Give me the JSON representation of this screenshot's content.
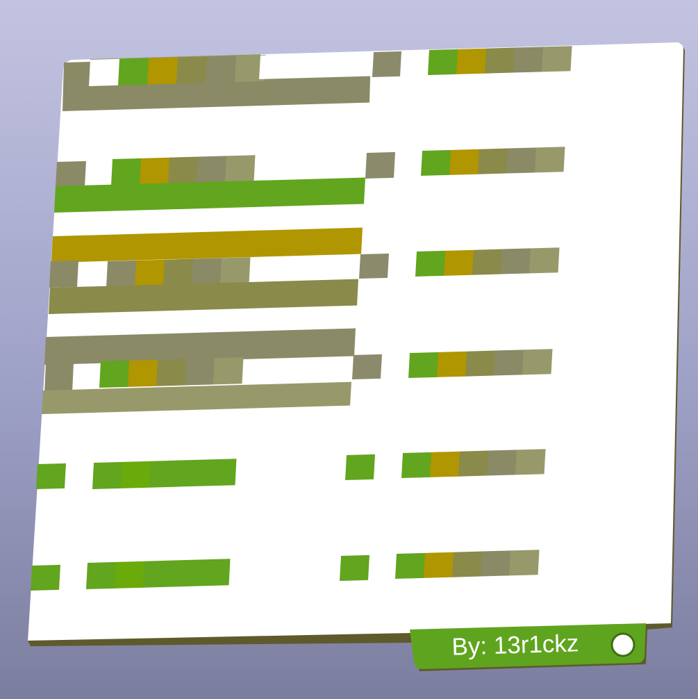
{
  "scene": {
    "description_type": "3d-render-of-pixel-art-plate",
    "colors": {
      "plate": "#ffffff",
      "plate_edge": "#5e5a2c",
      "tab": "#5fa41e",
      "hole": "#ffffff",
      "green": "#62a51e",
      "green2": "#6aaa0a",
      "gold": "#b09600",
      "olive": "#8a8a4a",
      "khaki": "#8a8a66",
      "sage": "#97996a",
      "taupe": "#8b8a6b"
    }
  },
  "tab": {
    "label": "By: 13r1ckz"
  }
}
